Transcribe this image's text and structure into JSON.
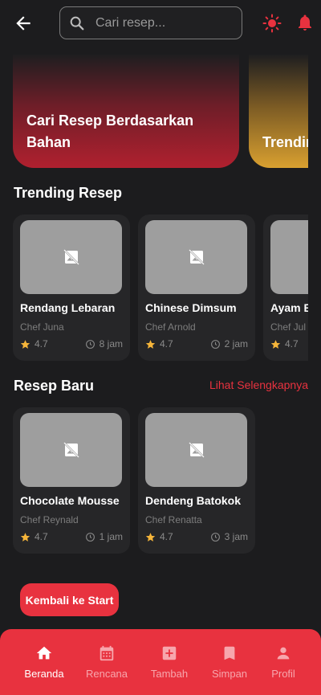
{
  "search": {
    "placeholder": "Cari resep..."
  },
  "banners": [
    {
      "text": "Cari Resep Berdasarkan Bahan"
    },
    {
      "text": "Trending"
    }
  ],
  "trending": {
    "title": "Trending Resep",
    "cards": [
      {
        "name": "Rendang Lebaran",
        "chef": "Chef Juna",
        "rating": "4.7",
        "time": "8 jam"
      },
      {
        "name": "Chinese Dimsum",
        "chef": "Chef Arnold",
        "rating": "4.7",
        "time": "2 jam"
      },
      {
        "name": "Ayam B",
        "chef": "Chef Jul",
        "rating": "4.7",
        "time": ""
      }
    ]
  },
  "new_recipes": {
    "title": "Resep Baru",
    "see_more": "Lihat Selengkapnya",
    "cards": [
      {
        "name": "Chocolate Mousse",
        "chef": "Chef Reynald",
        "rating": "4.7",
        "time": "1 jam"
      },
      {
        "name": "Dendeng Batokok",
        "chef": "Chef Renatta",
        "rating": "4.7",
        "time": "3 jam"
      }
    ]
  },
  "start_button": "Kembali ke Start",
  "nav": [
    {
      "label": "Beranda",
      "icon": "home-icon",
      "active": true
    },
    {
      "label": "Rencana",
      "icon": "calendar-icon",
      "active": false
    },
    {
      "label": "Tambah",
      "icon": "add-box-icon",
      "active": false
    },
    {
      "label": "Simpan",
      "icon": "bookmark-icon",
      "active": false
    },
    {
      "label": "Profil",
      "icon": "person-icon",
      "active": false
    }
  ],
  "colors": {
    "accent": "#e8323f",
    "background": "#1c1c1e",
    "card": "#262628",
    "star": "#f5b53a"
  }
}
